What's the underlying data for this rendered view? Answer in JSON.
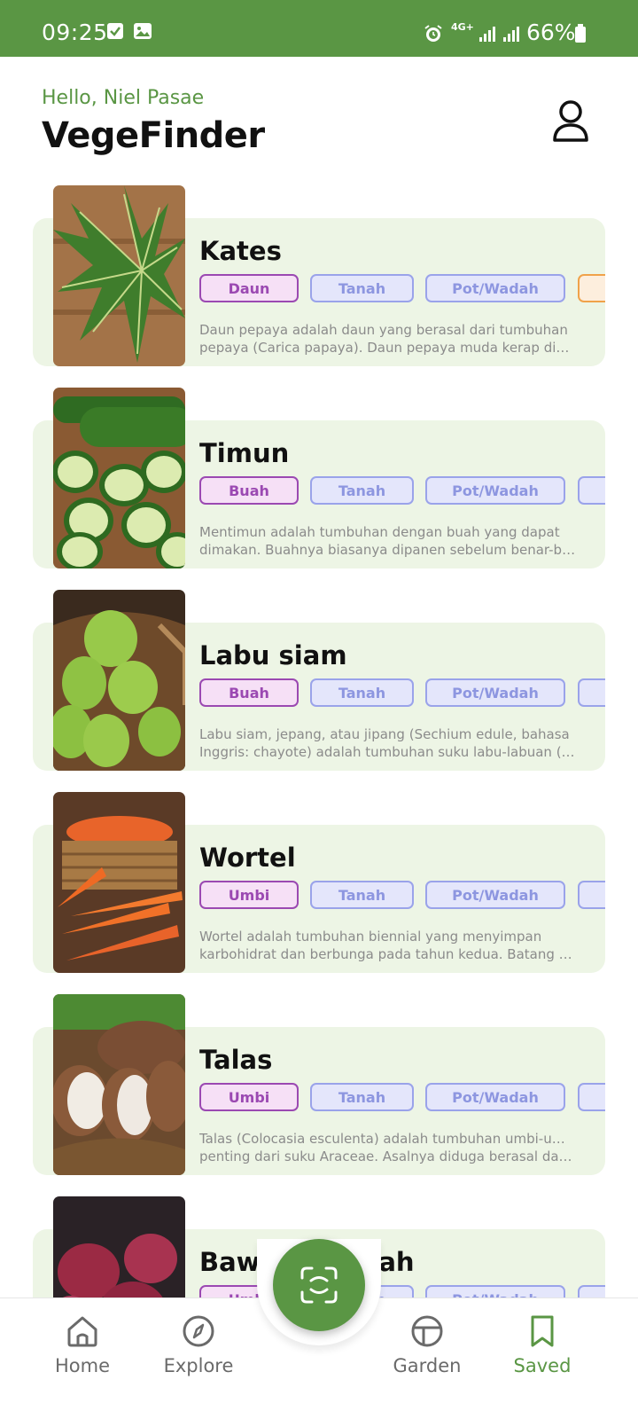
{
  "status_bar": {
    "time": "09:25",
    "network": "4G+",
    "battery": "66%"
  },
  "header": {
    "greeting": "Hello, Niel Pasae",
    "title": "VegeFinder",
    "profile_icon": "user-icon"
  },
  "plants": [
    {
      "name": "Kates",
      "tags": [
        "Daun",
        "Tanah",
        "Pot/Wadah"
      ],
      "desc1": "Daun pepaya adalah daun yang berasal dari tumbuhan",
      "desc2": "pepaya (Carica papaya). Daun pepaya muda kerap diolah m..."
    },
    {
      "name": "Timun",
      "tags": [
        "Buah",
        "Tanah",
        "Pot/Wadah"
      ],
      "desc1": "Mentimun adalah tumbuhan dengan buah yang dapat",
      "desc2": "dimakan. Buahnya biasanya dipanen sebelum benar-benar ..."
    },
    {
      "name": "Labu siam",
      "tags": [
        "Buah",
        "Tanah",
        "Pot/Wadah"
      ],
      "desc1": "Labu siam, jepang, atau jipang (Sechium edule, bahasa",
      "desc2": "Inggris: chayote) adalah tumbuhan suku labu-labuan (Cucur..."
    },
    {
      "name": "Wortel",
      "tags": [
        "Umbi",
        "Tanah",
        "Pot/Wadah"
      ],
      "desc1": "Wortel adalah tumbuhan biennial yang menyimpan",
      "desc2": "karbohidrat dan berbunga pada tahun kedua. Batang bunga ..."
    },
    {
      "name": "Talas",
      "tags": [
        "Umbi",
        "Tanah",
        "Pot/Wadah"
      ],
      "desc1": "Talas (Colocasia esculenta) adalah tumbuhan umbi-umbian",
      "desc2": "penting dari suku Araceae. Asalnya diduga berasal dari Asia ..."
    },
    {
      "name": "Bawang Merah",
      "tags": [
        "Umbi",
        "Tanah",
        "Pot/Wadah"
      ],
      "desc1": "",
      "desc2": ""
    }
  ],
  "nav": {
    "home": "Home",
    "explore": "Explore",
    "garden": "Garden",
    "saved": "Saved",
    "active": "Saved"
  },
  "colors": {
    "primary": "#5a9644",
    "card_bg": "#edf5e5",
    "part_tag": "#9b49b2",
    "info_tag": "#9aa3ea"
  }
}
